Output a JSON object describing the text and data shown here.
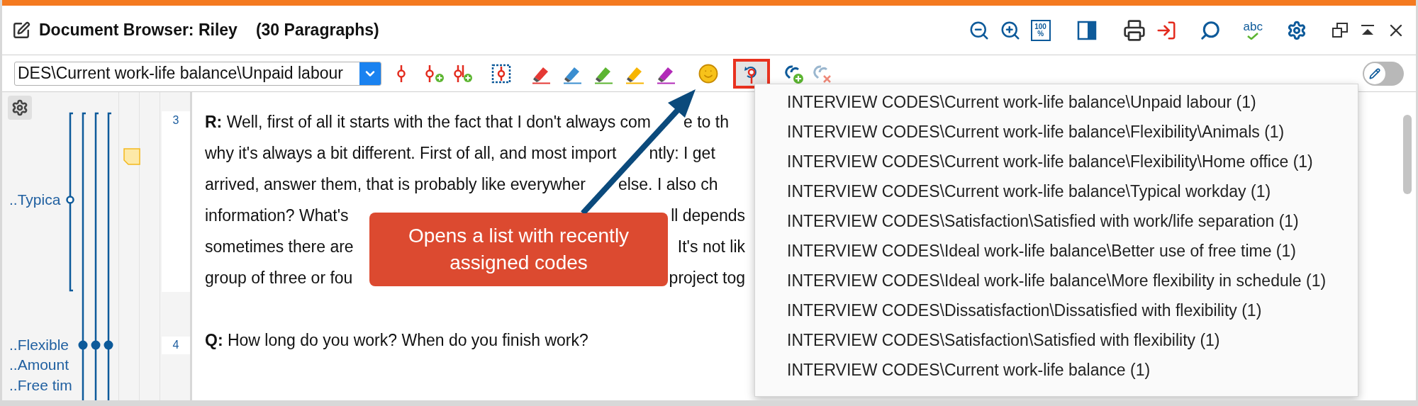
{
  "window": {
    "title": "Document Browser: Riley",
    "subtitle": "(30 Paragraphs)"
  },
  "title_icons": {
    "zoom_reset": [
      "100",
      "%"
    ],
    "spellcheck": "abc"
  },
  "toolbar": {
    "code_dropdown": {
      "value": "DES\\Current work-life balance\\Unpaid labour"
    },
    "highlighters": [
      {
        "color": "#e53935"
      },
      {
        "color": "#3b8ed0"
      },
      {
        "color": "#5cb531"
      },
      {
        "color": "#f7b500"
      },
      {
        "color": "#b22ab8"
      }
    ],
    "recent_codes_button": {
      "pressed": true
    },
    "edit_mode": {
      "on": false
    }
  },
  "margin": {
    "code_labels": [
      "..Typica",
      "..Flexible",
      "..Amount",
      "..Free tim"
    ]
  },
  "paragraphs": [
    {
      "number": "3",
      "lines": [
        {
          "left": "**R:** Well, first of all it starts with the fact that I don't always com",
          "after_arrow": "e to th"
        },
        {
          "left": "why it's always a bit different. First of all, and most import",
          "after_arrow": "ntly: I get"
        },
        {
          "left": "arrived, answer them, that is probably like everywher",
          "after_arrow": "else. I also ch"
        },
        {
          "left": "information? What's",
          "right": "ll depends"
        },
        {
          "left": "sometimes there are",
          "right": "It's not lik"
        },
        {
          "left": "group of three or fou",
          "right": "project tog"
        }
      ]
    },
    {
      "number": "4",
      "lines": [
        {
          "left": "**Q:** How long do you work? When do you finish work?"
        }
      ]
    }
  ],
  "callout": {
    "text": "Opens a list with recently assigned codes"
  },
  "recent_codes_menu": {
    "items": [
      "INTERVIEW CODES\\Current work-life balance\\Unpaid labour (1)",
      "INTERVIEW CODES\\Current work-life balance\\Flexibility\\Animals (1)",
      "INTERVIEW CODES\\Current work-life balance\\Flexibility\\Home office (1)",
      "INTERVIEW CODES\\Current work-life balance\\Typical workday (1)",
      "INTERVIEW CODES\\Satisfaction\\Satisfied with work/life separation (1)",
      "INTERVIEW CODES\\Ideal work-life balance\\Better use of free time (1)",
      "INTERVIEW CODES\\Ideal work-life balance\\More flexibility in schedule (1)",
      "INTERVIEW CODES\\Dissatisfaction\\Dissatisfied with flexibility (1)",
      "INTERVIEW CODES\\Satisfaction\\Satisfied with flexibility (1)",
      "INTERVIEW CODES\\Current work-life balance (1)"
    ]
  }
}
